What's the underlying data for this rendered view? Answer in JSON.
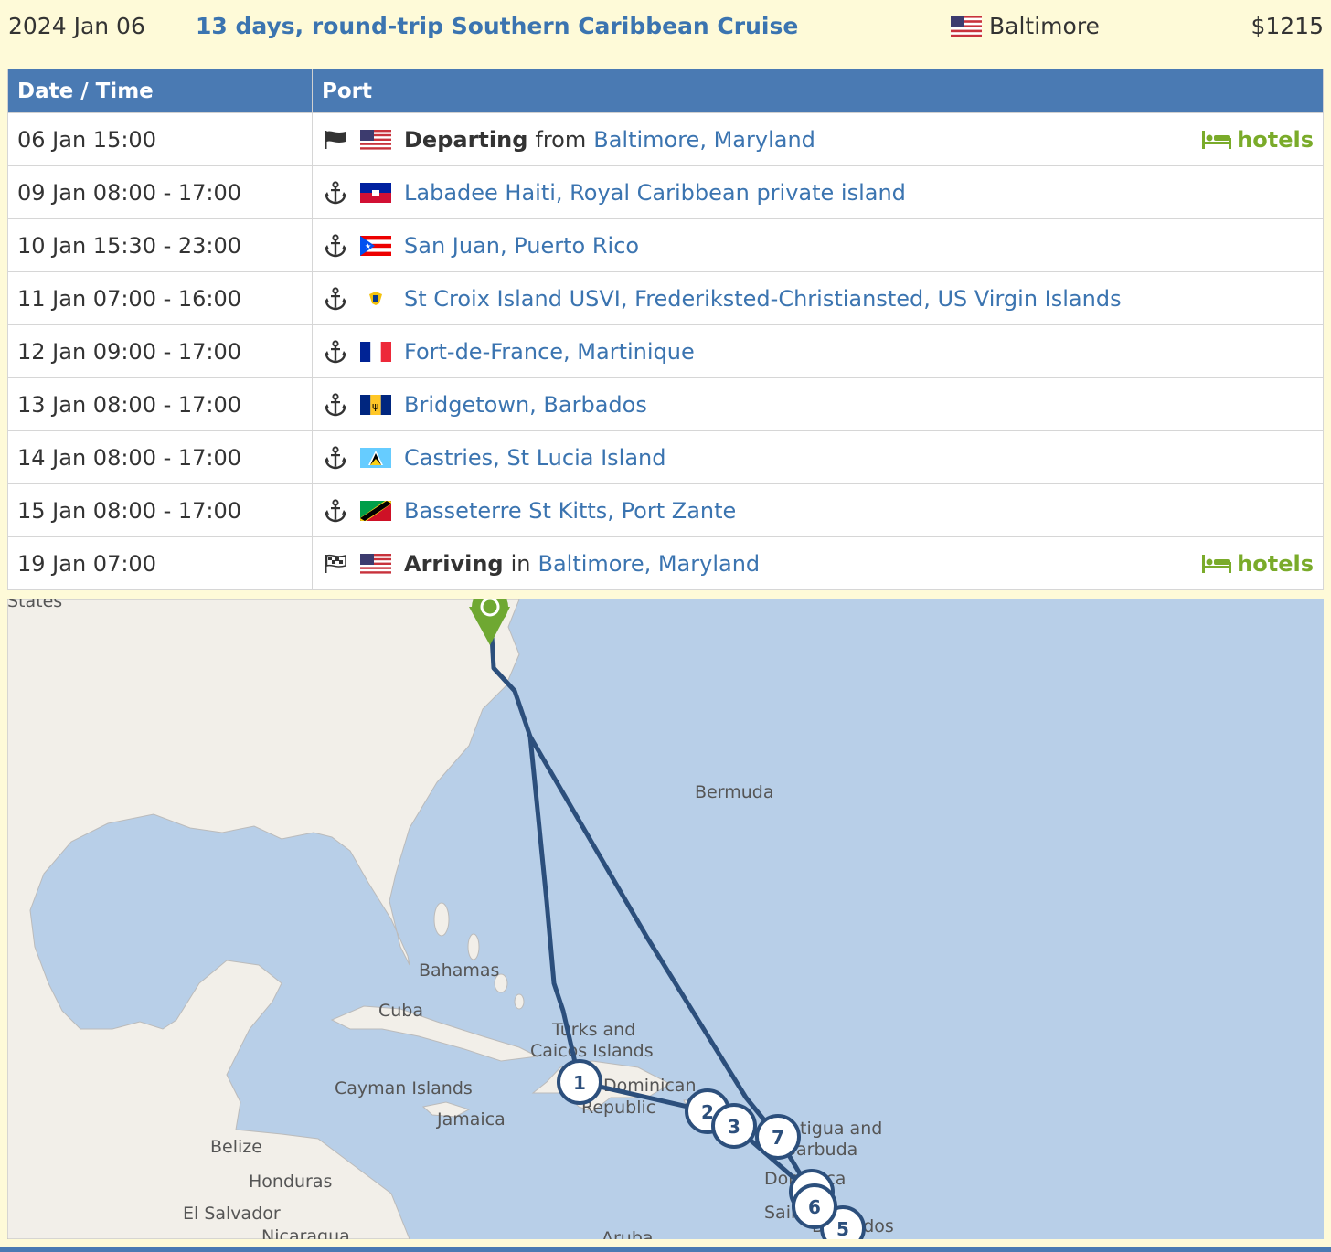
{
  "header": {
    "date": "2024 Jan 06",
    "title": "13 days, round-trip Southern Caribbean Cruise",
    "port": "Baltimore",
    "price": "$1215"
  },
  "table": {
    "col_datetime": "Date / Time",
    "col_port": "Port",
    "hotels_label": "hotels",
    "rows": [
      {
        "datetime": "06 Jan 15:00",
        "icon": "flag-icon",
        "flag": "us",
        "prefix": "Departing",
        "mid": "from",
        "port": "Baltimore, Maryland",
        "hotels": true
      },
      {
        "datetime": "09 Jan 08:00 - 17:00",
        "icon": "anchor-icon",
        "flag": "ht",
        "port": "Labadee Haiti, Royal Caribbean private island"
      },
      {
        "datetime": "10 Jan 15:30 - 23:00",
        "icon": "anchor-icon",
        "flag": "pr",
        "port": "San Juan, Puerto Rico"
      },
      {
        "datetime": "11 Jan 07:00 - 16:00",
        "icon": "anchor-icon",
        "flag": "vi",
        "port": "St Croix Island USVI, Frederiksted-Christiansted, US Virgin Islands"
      },
      {
        "datetime": "12 Jan 09:00 - 17:00",
        "icon": "anchor-icon",
        "flag": "fr",
        "port": "Fort-de-France, Martinique"
      },
      {
        "datetime": "13 Jan 08:00 - 17:00",
        "icon": "anchor-icon",
        "flag": "bb",
        "port": "Bridgetown, Barbados"
      },
      {
        "datetime": "14 Jan 08:00 - 17:00",
        "icon": "anchor-icon",
        "flag": "lc",
        "port": "Castries, St Lucia Island"
      },
      {
        "datetime": "15 Jan 08:00 - 17:00",
        "icon": "anchor-icon",
        "flag": "kn",
        "port": "Basseterre St Kitts, Port Zante"
      },
      {
        "datetime": "19 Jan 07:00",
        "icon": "checkered-flag-icon",
        "flag": "us",
        "prefix": "Arriving",
        "mid": "in",
        "port": "Baltimore, Maryland",
        "hotels": true
      }
    ]
  },
  "map": {
    "labels": [
      "Bermuda",
      "Bahamas",
      "Cuba",
      "Turks and",
      "Caicos Islands",
      "Cayman Islands",
      "Jamaica",
      "Dominican",
      "Republic",
      "Belize",
      "Honduras",
      "El Salvador",
      "Nicaragua",
      "Aruba",
      "Antigua and",
      "Barbuda",
      "Dominica",
      "Saint",
      "Barbados",
      "States"
    ],
    "markers": [
      "1",
      "2",
      "3",
      "7",
      "6",
      "5"
    ],
    "route_color": "#2c4f7c",
    "water_color": "#b8cfe8",
    "land_color": "#f2efe9"
  },
  "colors": {
    "accent": "#4a7ab3",
    "link": "#3b74b0",
    "hotels": "#7aab2a",
    "background": "#fefad8"
  }
}
